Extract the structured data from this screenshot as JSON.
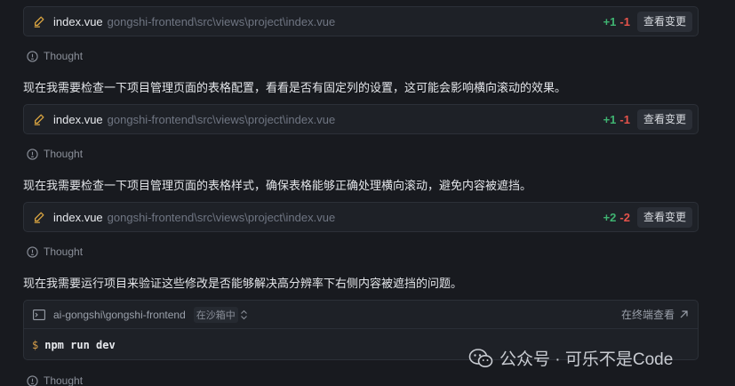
{
  "cards": [
    {
      "filename": "index.vue",
      "path": "gongshi-frontend\\src\\views\\project\\index.vue",
      "additions": "+1",
      "deletions": "-1",
      "button": "查看变更"
    },
    {
      "filename": "index.vue",
      "path": "gongshi-frontend\\src\\views\\project\\index.vue",
      "additions": "+1",
      "deletions": "-1",
      "button": "查看变更"
    },
    {
      "filename": "index.vue",
      "path": "gongshi-frontend\\src\\views\\project\\index.vue",
      "additions": "+2",
      "deletions": "-2",
      "button": "查看变更"
    }
  ],
  "thoughts": [
    "Thought",
    "Thought",
    "Thought",
    "Thought"
  ],
  "paragraphs": [
    "现在我需要检查一下项目管理页面的表格配置，看看是否有固定列的设置，这可能会影响横向滚动的效果。",
    "现在我需要检查一下项目管理页面的表格样式，确保表格能够正确处理横向滚动，避免内容被遮挡。",
    "现在我需要运行项目来验证这些修改是否能够解决高分辨率下右侧内容被遮挡的问题。"
  ],
  "terminal": {
    "path": "ai-gongshi\\gongshi-frontend",
    "sandbox": "在沙箱中",
    "open_label": "在终端查看",
    "prompt": "$",
    "command": "npm run dev"
  },
  "watermark": "公众号 · 可乐不是Code",
  "colors": {
    "background": "#181a1f",
    "card": "#1e2127",
    "addition": "#3fb371",
    "deletion": "#e5534b",
    "prompt": "#d8a04a"
  },
  "icons": [
    "edit-icon",
    "bulb-icon",
    "terminal-icon",
    "chevron-updown-icon",
    "arrow-up-right-icon",
    "wechat-icon"
  ]
}
